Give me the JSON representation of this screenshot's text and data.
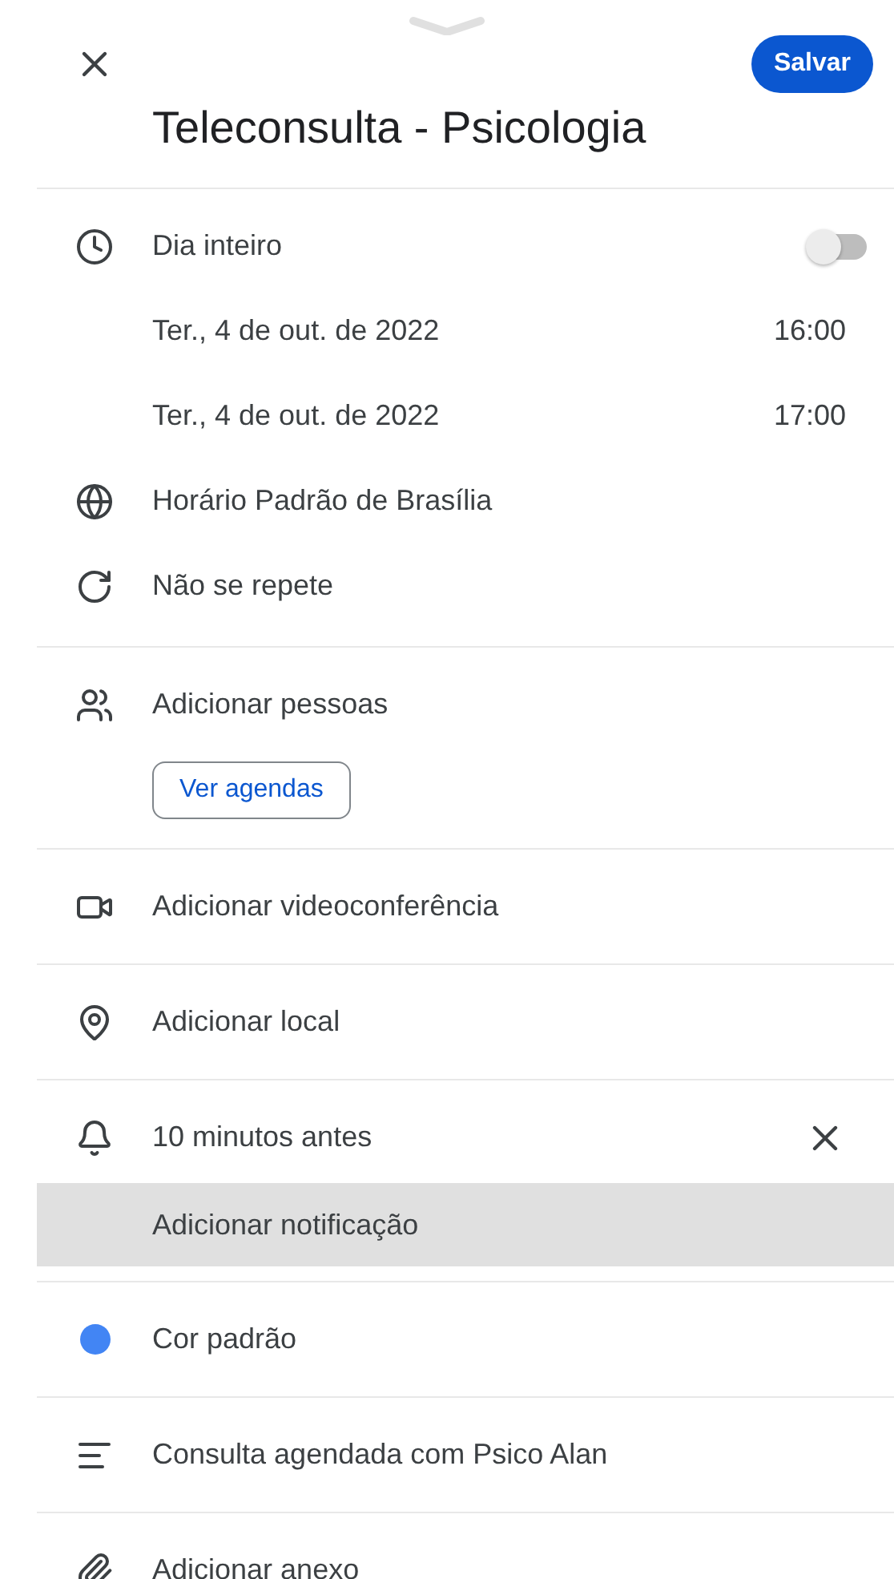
{
  "header": {
    "save": "Salvar",
    "title": "Teleconsulta - Psicologia"
  },
  "sections": [
    {
      "rows": [
        {
          "kind": "all-day",
          "label": "Dia inteiro",
          "on": false
        },
        {
          "kind": "date",
          "label": "Ter., 4 de out. de 2022",
          "time": "16:00"
        },
        {
          "kind": "date",
          "label": "Ter., 4 de out. de 2022",
          "time": "17:00"
        },
        {
          "kind": "timezone",
          "label": "Horário Padrão de Brasília"
        },
        {
          "kind": "repeat",
          "label": "Não se repete"
        }
      ]
    },
    {
      "rows": [
        {
          "kind": "people",
          "label": "Adicionar pessoas"
        },
        {
          "kind": "button",
          "label": "Ver agendas"
        }
      ]
    },
    {
      "rows": [
        {
          "kind": "video",
          "label": "Adicionar videoconferência"
        }
      ]
    },
    {
      "rows": [
        {
          "kind": "location",
          "label": "Adicionar local"
        }
      ]
    },
    {
      "rows": [
        {
          "kind": "notification",
          "label": "10 minutos antes"
        },
        {
          "kind": "add-notification",
          "label": "Adicionar notificação",
          "highlighted": true
        }
      ]
    },
    {
      "rows": [
        {
          "kind": "color",
          "label": "Cor padrão",
          "color": "#4285f4"
        }
      ]
    },
    {
      "rows": [
        {
          "kind": "description",
          "label": "Consulta agendada com Psico Alan"
        }
      ]
    },
    {
      "rows": [
        {
          "kind": "attachment",
          "label": "Adicionar anexo"
        }
      ]
    }
  ]
}
